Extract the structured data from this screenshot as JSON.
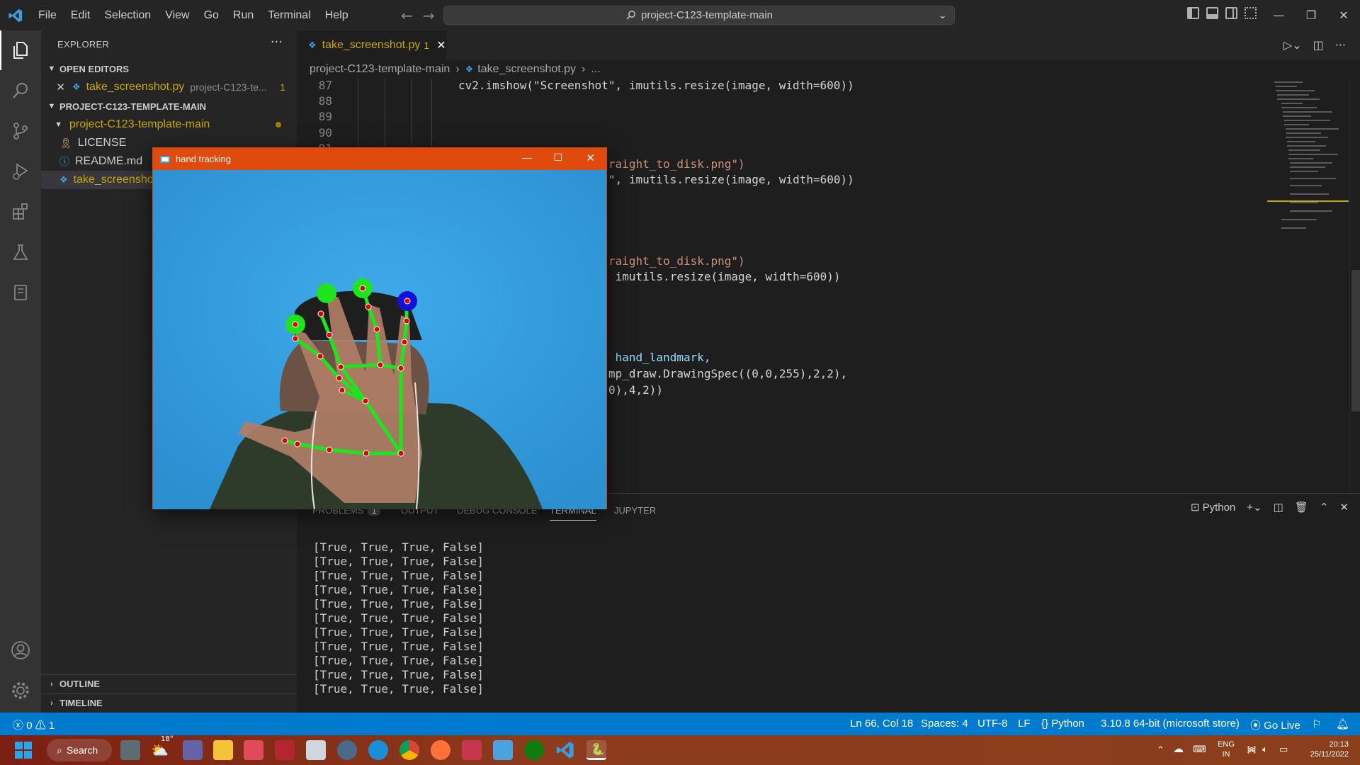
{
  "menubar": {
    "items": [
      "File",
      "Edit",
      "Selection",
      "View",
      "Go",
      "Run",
      "Terminal",
      "Help"
    ]
  },
  "command_center": {
    "text": "project-C123-template-main"
  },
  "sidebar": {
    "title": "EXPLORER",
    "more": "···",
    "open_editors": {
      "label": "OPEN EDITORS",
      "items": [
        {
          "name": "take_screenshot.py",
          "path": "project-C123-te...",
          "problems": "1"
        }
      ]
    },
    "project": {
      "label": "PROJECT-C123-TEMPLATE-MAIN",
      "folder": "project-C123-template-main",
      "files": [
        "LICENSE",
        "README.md",
        "take_screenshot.py"
      ]
    },
    "outline": "OUTLINE",
    "timeline": "TIMELINE"
  },
  "tab": {
    "name": "take_screenshot.py",
    "problems": "1"
  },
  "breadcrumb": [
    "project-C123-template-main",
    "take_screenshot.py",
    "..."
  ],
  "code": {
    "line_numbers": [
      "87",
      "88",
      "89",
      "90",
      "91"
    ],
    "lines": [
      {
        "text": "cv2.imshow(\"Screenshot\", imutils.resize(image, width=600))"
      },
      {
        "text": "raight_to_disk.png\")"
      },
      {
        "text": "\", imutils.resize(image, width=600))"
      },
      {
        "text": "raight_to_disk.png\")"
      },
      {
        "text": " imutils.resize(image, width=600))"
      },
      {
        "text": " hand_landmark,"
      },
      {
        "text": "mp_draw.DrawingSpec((0,0,255),2,2),"
      },
      {
        "text": "0),4,2))"
      }
    ]
  },
  "panel": {
    "tabs": [
      "PROBLEMS",
      "OUTPUT",
      "DEBUG CONSOLE",
      "TERMINAL",
      "JUPYTER"
    ],
    "problems_count": "1",
    "active": "TERMINAL",
    "shell": "Python",
    "terminal_lines": [
      "[True, True, True, False]",
      "[True, True, True, False]",
      "[True, True, True, False]",
      "[True, True, True, False]",
      "[True, True, True, False]",
      "[True, True, True, False]",
      "[True, True, True, False]",
      "[True, True, True, False]",
      "[True, True, True, False]",
      "[True, True, True, False]",
      "[True, True, True, False]"
    ]
  },
  "statusbar": {
    "errors": "0",
    "warnings": "1",
    "position": "Ln 66, Col 18",
    "spaces": "Spaces: 4",
    "encoding": "UTF-8",
    "eol": "LF",
    "language": "Python",
    "interpreter": "3.10.8 64-bit (microsoft store)",
    "go_live": "Go Live"
  },
  "handwin": {
    "title": "hand tracking"
  },
  "taskbar": {
    "search": "Search",
    "weather": "18°",
    "lang1": "ENG",
    "lang2": "IN",
    "time": "20:13",
    "date": "25/11/2022"
  }
}
